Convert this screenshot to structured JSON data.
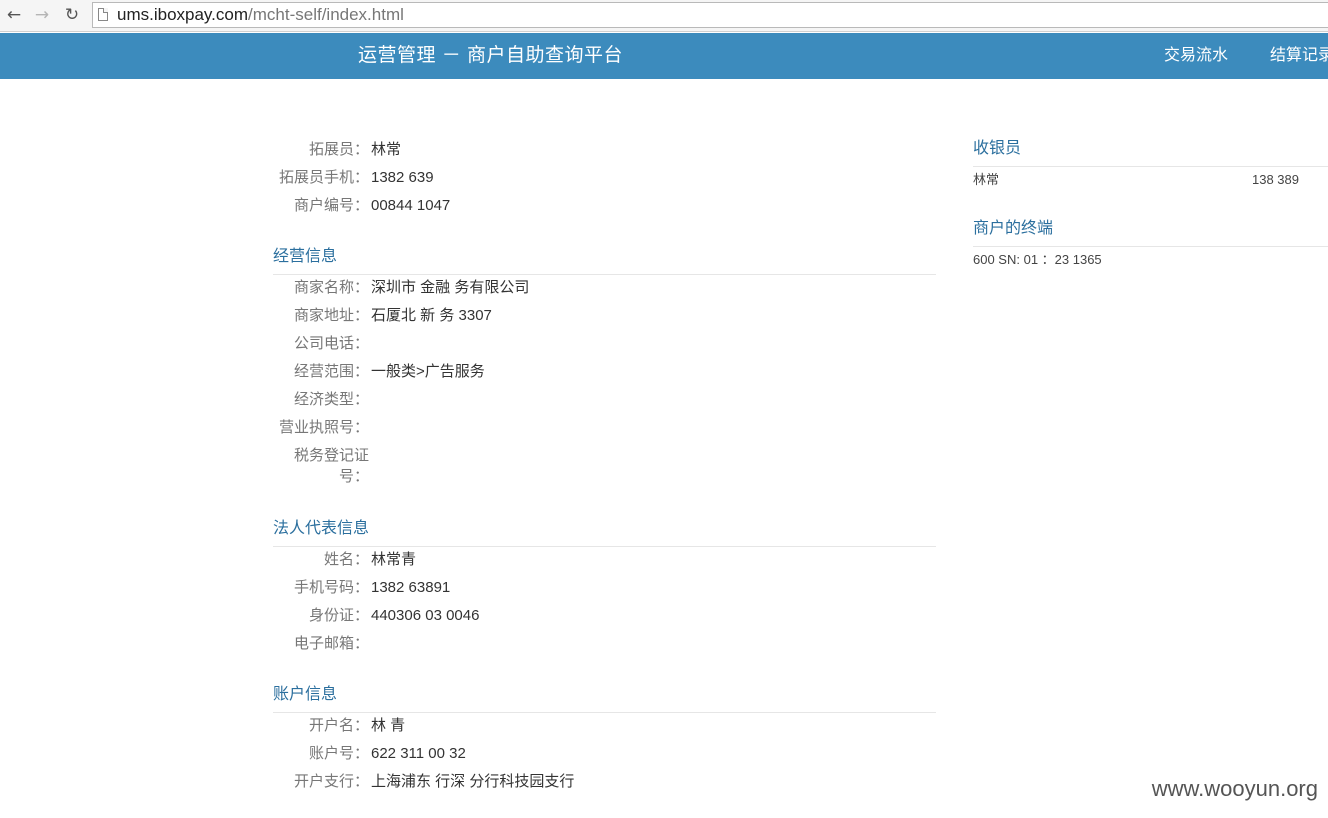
{
  "browser": {
    "url_host": "ums.iboxpay.com",
    "url_path": "/mcht-self/index.html"
  },
  "header": {
    "title": "运营管理 － 商户自助查询平台",
    "nav": [
      "交易流水",
      "结算记录"
    ]
  },
  "expander": {
    "rows": [
      {
        "label": "拓展员：",
        "value": "林常"
      },
      {
        "label": "拓展员手机：",
        "value": "1382 639"
      },
      {
        "label": "商户编号：",
        "value": "00844 1047"
      }
    ]
  },
  "business": {
    "title": "经营信息",
    "rows": [
      {
        "label": "商家名称：",
        "value": "深圳市 金融 务有限公司"
      },
      {
        "label": "商家地址：",
        "value": "石厦北 新 务 3307"
      },
      {
        "label": "公司电话：",
        "value": ""
      },
      {
        "label": "经营范围：",
        "value": "一般类>广告服务"
      },
      {
        "label": "经济类型：",
        "value": ""
      },
      {
        "label": "营业执照号：",
        "value": ""
      },
      {
        "label": "税务登记证号：",
        "value": ""
      }
    ]
  },
  "legal": {
    "title": "法人代表信息",
    "rows": [
      {
        "label": "姓名：",
        "value": "林常青"
      },
      {
        "label": "手机号码：",
        "value": "1382 63891"
      },
      {
        "label": "身份证：",
        "value": "440306 03 0046"
      },
      {
        "label": "电子邮箱：",
        "value": ""
      }
    ]
  },
  "account": {
    "title": "账户信息",
    "rows": [
      {
        "label": "开户名：",
        "value": "林 青"
      },
      {
        "label": "账户号：",
        "value": "622 311 00 32"
      },
      {
        "label": "开户支行：",
        "value": "上海浦东 行深 分行科技园支行"
      }
    ]
  },
  "cashier": {
    "title": "收银员",
    "name": "林常",
    "phone": "138 389"
  },
  "terminals": {
    "title": "商户的终端",
    "line": "600 SN: 01 ：23 1365"
  },
  "watermark": "www.wooyun.org"
}
